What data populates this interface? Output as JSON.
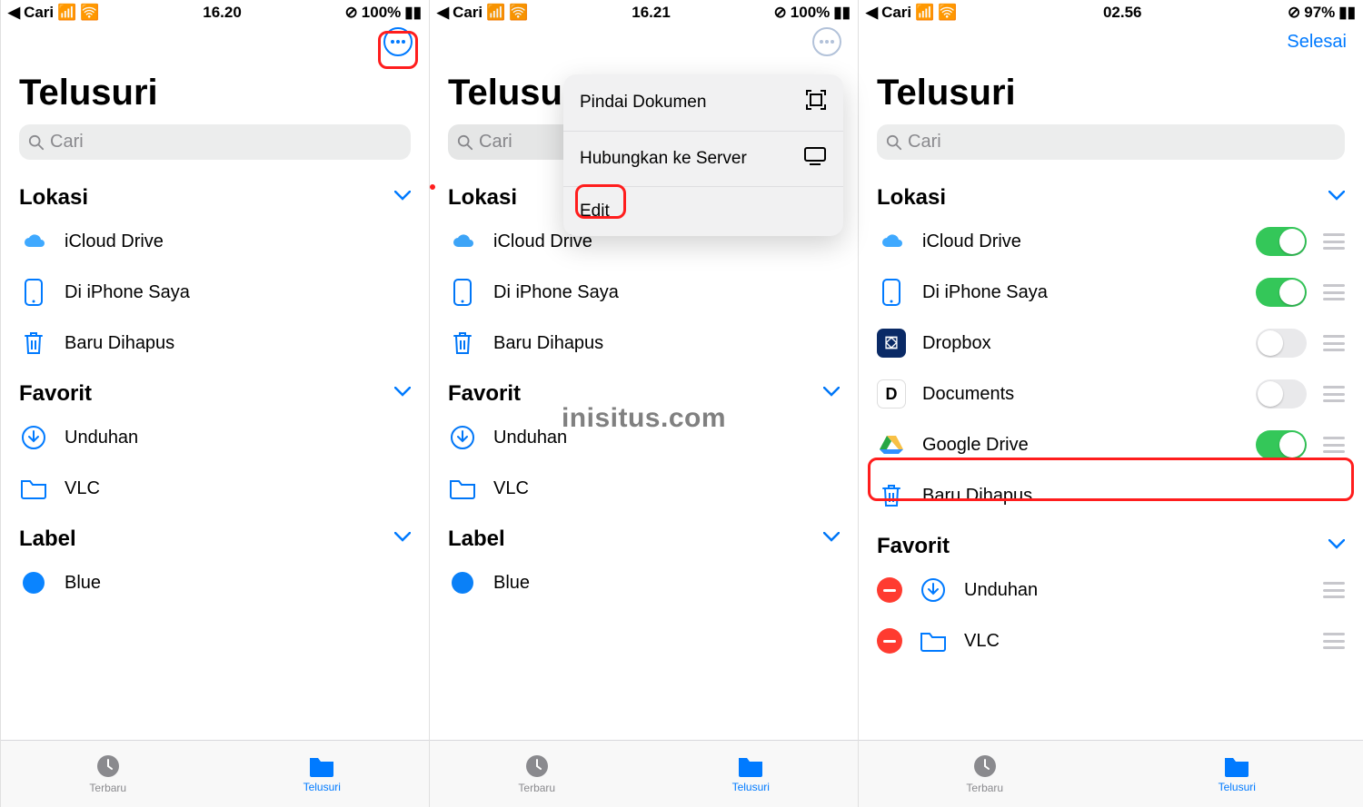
{
  "watermark": "inisitus.com",
  "panels": [
    {
      "status": {
        "back": "Cari",
        "time": "16.20",
        "battery": "100%"
      },
      "title": "Telusuri",
      "searchPlaceholder": "Cari",
      "doneLabel": null,
      "sections": {
        "lokasi": {
          "title": "Lokasi",
          "items": [
            {
              "name": "icloud",
              "label": "iCloud Drive"
            },
            {
              "name": "iphone",
              "label": "Di iPhone Saya"
            },
            {
              "name": "trash",
              "label": "Baru Dihapus"
            }
          ]
        },
        "favorit": {
          "title": "Favorit",
          "items": [
            {
              "name": "downloads",
              "label": "Unduhan"
            },
            {
              "name": "vlc",
              "label": "VLC"
            }
          ]
        },
        "label": {
          "title": "Label",
          "items": [
            {
              "name": "blue",
              "label": "Blue"
            }
          ]
        }
      },
      "tabs": {
        "recent": "Terbaru",
        "browse": "Telusuri"
      }
    },
    {
      "status": {
        "back": "Cari",
        "time": "16.21",
        "battery": "100%"
      },
      "title": "Telusuri",
      "searchPlaceholder": "Cari",
      "popup": {
        "scan": "Pindai Dokumen",
        "connect": "Hubungkan ke Server",
        "edit": "Edit"
      },
      "sections": {
        "lokasi": {
          "title": "Lokasi",
          "items": [
            {
              "name": "icloud",
              "label": "iCloud Drive"
            },
            {
              "name": "iphone",
              "label": "Di iPhone Saya"
            },
            {
              "name": "trash",
              "label": "Baru Dihapus"
            }
          ]
        },
        "favorit": {
          "title": "Favorit",
          "items": [
            {
              "name": "downloads",
              "label": "Unduhan"
            },
            {
              "name": "vlc",
              "label": "VLC"
            }
          ]
        },
        "label": {
          "title": "Label",
          "items": [
            {
              "name": "blue",
              "label": "Blue"
            }
          ]
        }
      },
      "tabs": {
        "recent": "Terbaru",
        "browse": "Telusuri"
      }
    },
    {
      "status": {
        "back": "Cari",
        "time": "02.56",
        "battery": "97%"
      },
      "title": "Telusuri",
      "doneLabel": "Selesai",
      "searchPlaceholder": "Cari",
      "sections": {
        "lokasi": {
          "title": "Lokasi",
          "items": [
            {
              "name": "icloud",
              "label": "iCloud Drive",
              "toggle": true
            },
            {
              "name": "iphone",
              "label": "Di iPhone Saya",
              "toggle": true
            },
            {
              "name": "dropbox",
              "label": "Dropbox",
              "toggle": false
            },
            {
              "name": "documents",
              "label": "Documents",
              "toggle": false
            },
            {
              "name": "gdrive",
              "label": "Google Drive",
              "toggle": true
            },
            {
              "name": "trash",
              "label": "Baru Dihapus"
            }
          ]
        },
        "favorit": {
          "title": "Favorit",
          "items": [
            {
              "name": "downloads",
              "label": "Unduhan"
            },
            {
              "name": "vlc",
              "label": "VLC"
            }
          ]
        }
      },
      "tabs": {
        "recent": "Terbaru",
        "browse": "Telusuri"
      }
    }
  ]
}
